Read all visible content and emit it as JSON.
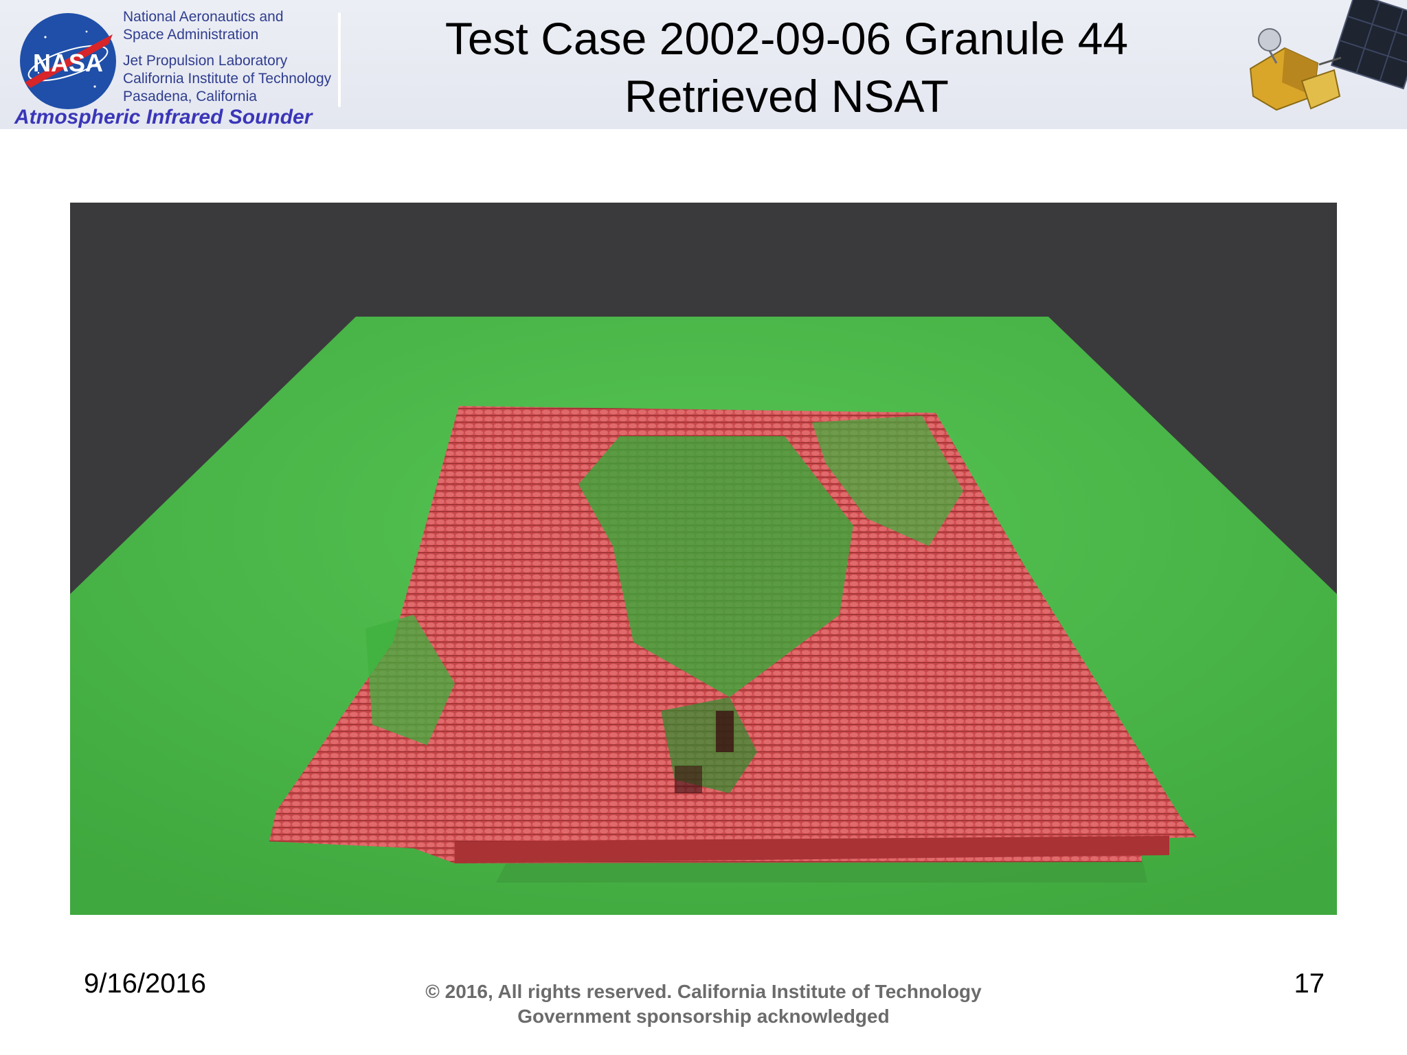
{
  "header": {
    "org_lines": [
      "National Aeronautics and",
      "Space Administration",
      "Jet Propulsion Laboratory",
      "California Institute of Technology",
      "Pasadena, California"
    ],
    "mission": "Atmospheric Infrared Sounder",
    "logo_text": "NASA",
    "title_line1": "Test Case 2002-09-06 Granule 44",
    "title_line2": "Retrieved NSAT"
  },
  "figure": {
    "icon": "3d-voxel-visualization",
    "colors": {
      "background": "#3a3a3c",
      "ground": "#4cbc4a",
      "columns": "#cf4648"
    }
  },
  "footer": {
    "date": "9/16/2016",
    "copyright_line1": "© 2016, All rights reserved. California Institute of Technology",
    "copyright_line2": "Government sponsorship acknowledged",
    "page_number": "17"
  }
}
